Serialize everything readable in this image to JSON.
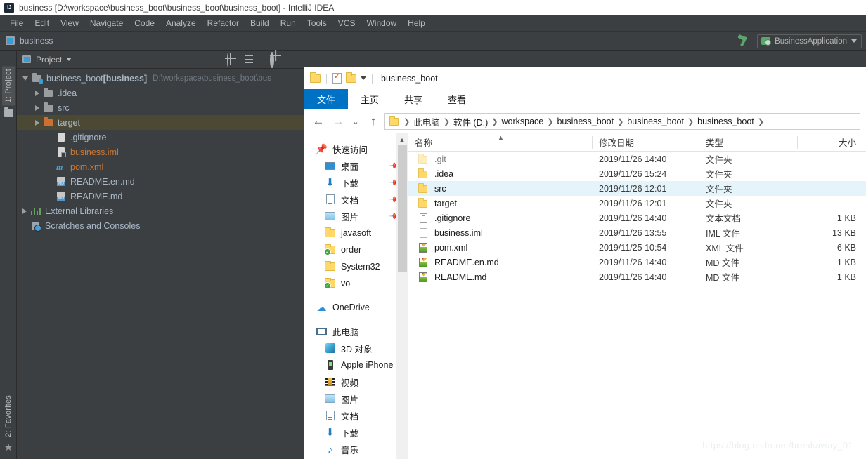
{
  "ide": {
    "window_title": "business [D:\\workspace\\business_boot\\business_boot\\business_boot] - IntelliJ IDEA",
    "logo_text": "IJ",
    "menus": [
      {
        "label": "File",
        "mnemonic": "F"
      },
      {
        "label": "Edit",
        "mnemonic": "E"
      },
      {
        "label": "View",
        "mnemonic": "V"
      },
      {
        "label": "Navigate",
        "mnemonic": "N"
      },
      {
        "label": "Code",
        "mnemonic": "C"
      },
      {
        "label": "Analyze",
        "mnemonic": "z"
      },
      {
        "label": "Refactor",
        "mnemonic": "R"
      },
      {
        "label": "Build",
        "mnemonic": "B"
      },
      {
        "label": "Run",
        "mnemonic": "u"
      },
      {
        "label": "Tools",
        "mnemonic": "T"
      },
      {
        "label": "VCS",
        "mnemonic": "S"
      },
      {
        "label": "Window",
        "mnemonic": "W"
      },
      {
        "label": "Help",
        "mnemonic": "H"
      }
    ],
    "navbar": {
      "module": "business"
    },
    "run_config": {
      "label": "BusinessApplication"
    },
    "toolwindow_strip": {
      "top": "1: Project",
      "bottom": "2: Favorites"
    },
    "project_panel": {
      "title": "Project",
      "tools": [
        "locate-icon",
        "collapse-all-icon",
        "settings-gear-icon",
        "minimize-icon"
      ],
      "tree": [
        {
          "label": "business_boot",
          "bracket": "[business]",
          "path": "D:\\workspace\\business_boot\\bus",
          "icon": "module-folder-icon",
          "state": "open",
          "depth": 0
        },
        {
          "label": ".idea",
          "icon": "folder-icon",
          "state": "closed",
          "depth": 1
        },
        {
          "label": "src",
          "icon": "folder-icon",
          "state": "closed",
          "depth": 1
        },
        {
          "label": "target",
          "icon": "folder-orange-icon",
          "state": "closed",
          "depth": 1,
          "highlighted": true
        },
        {
          "label": ".gitignore",
          "icon": "text-file-icon",
          "depth": 2
        },
        {
          "label": "business.iml",
          "icon": "iml-file-icon",
          "depth": 2,
          "orange": true
        },
        {
          "label": "pom.xml",
          "icon": "maven-file-icon",
          "depth": 2,
          "orange": true
        },
        {
          "label": "README.en.md",
          "icon": "markdown-file-icon",
          "depth": 2
        },
        {
          "label": "README.md",
          "icon": "markdown-file-icon",
          "depth": 2
        },
        {
          "label": "External Libraries",
          "icon": "libraries-icon",
          "state": "closed",
          "depth": 0
        },
        {
          "label": "Scratches and Consoles",
          "icon": "scratches-icon",
          "depth": 0
        }
      ]
    }
  },
  "explorer": {
    "quick_access_title": "business_boot",
    "quick_access_icons": [
      "folder-icon",
      "properties-icon",
      "new-folder-icon",
      "customize-caret-icon"
    ],
    "ribbon_tabs": [
      {
        "label": "文件",
        "active": true
      },
      {
        "label": "主页",
        "active": false
      },
      {
        "label": "共享",
        "active": false
      },
      {
        "label": "查看",
        "active": false
      }
    ],
    "address": {
      "back": "←",
      "forward": "→",
      "recent": "⌄",
      "up": "↑",
      "crumbs": [
        "此电脑",
        "软件 (D:)",
        "workspace",
        "business_boot",
        "business_boot",
        "business_boot"
      ]
    },
    "nav_pane": {
      "quick_access_label": "快速访问",
      "quick_access_items": [
        {
          "label": "桌面",
          "icon": "desktop-icon",
          "pinned": true
        },
        {
          "label": "下载",
          "icon": "downloads-icon",
          "pinned": true
        },
        {
          "label": "文档",
          "icon": "documents-icon",
          "pinned": true
        },
        {
          "label": "图片",
          "icon": "pictures-icon",
          "pinned": true
        },
        {
          "label": "javasoft",
          "icon": "folder-icon",
          "pinned": false
        },
        {
          "label": "order",
          "icon": "folder-synced-icon",
          "pinned": false
        },
        {
          "label": "System32",
          "icon": "folder-icon",
          "pinned": false
        },
        {
          "label": "vo",
          "icon": "folder-synced-icon",
          "pinned": false
        }
      ],
      "onedrive_label": "OneDrive",
      "this_pc_label": "此电脑",
      "this_pc_items": [
        {
          "label": "3D 对象",
          "icon": "3d-objects-icon"
        },
        {
          "label": "Apple iPhone",
          "icon": "phone-icon"
        },
        {
          "label": "视频",
          "icon": "videos-icon"
        },
        {
          "label": "图片",
          "icon": "pictures-icon"
        },
        {
          "label": "文档",
          "icon": "documents-icon"
        },
        {
          "label": "下载",
          "icon": "downloads-icon"
        },
        {
          "label": "音乐",
          "icon": "music-icon"
        }
      ]
    },
    "columns": {
      "name": "名称",
      "date": "修改日期",
      "type": "类型",
      "size": "大小"
    },
    "files": [
      {
        "name": ".git",
        "date": "2019/11/26 14:40",
        "type": "文件夹",
        "size": "",
        "icon": "folder-icon",
        "hidden": true,
        "selected": false
      },
      {
        "name": ".idea",
        "date": "2019/11/26 15:24",
        "type": "文件夹",
        "size": "",
        "icon": "folder-icon",
        "hidden": false,
        "selected": false
      },
      {
        "name": "src",
        "date": "2019/11/26 12:01",
        "type": "文件夹",
        "size": "",
        "icon": "folder-icon",
        "hidden": false,
        "selected": true
      },
      {
        "name": "target",
        "date": "2019/11/26 12:01",
        "type": "文件夹",
        "size": "",
        "icon": "folder-icon",
        "hidden": false,
        "selected": false
      },
      {
        "name": ".gitignore",
        "date": "2019/11/26 14:40",
        "type": "文本文档",
        "size": "1 KB",
        "icon": "text-file-icon",
        "hidden": false,
        "selected": false
      },
      {
        "name": "business.iml",
        "date": "2019/11/26 13:55",
        "type": "IML 文件",
        "size": "13 KB",
        "icon": "blank-file-icon",
        "hidden": false,
        "selected": false
      },
      {
        "name": "pom.xml",
        "date": "2019/11/25 10:54",
        "type": "XML 文件",
        "size": "6 KB",
        "icon": "edit-file-icon",
        "hidden": false,
        "selected": false
      },
      {
        "name": "README.en.md",
        "date": "2019/11/26 14:40",
        "type": "MD 文件",
        "size": "1 KB",
        "icon": "edit-file-icon",
        "hidden": false,
        "selected": false
      },
      {
        "name": "README.md",
        "date": "2019/11/26 14:40",
        "type": "MD 文件",
        "size": "1 KB",
        "icon": "edit-file-icon",
        "hidden": false,
        "selected": false
      }
    ]
  },
  "watermark": "https://blog.csdn.net/breakaway_01"
}
